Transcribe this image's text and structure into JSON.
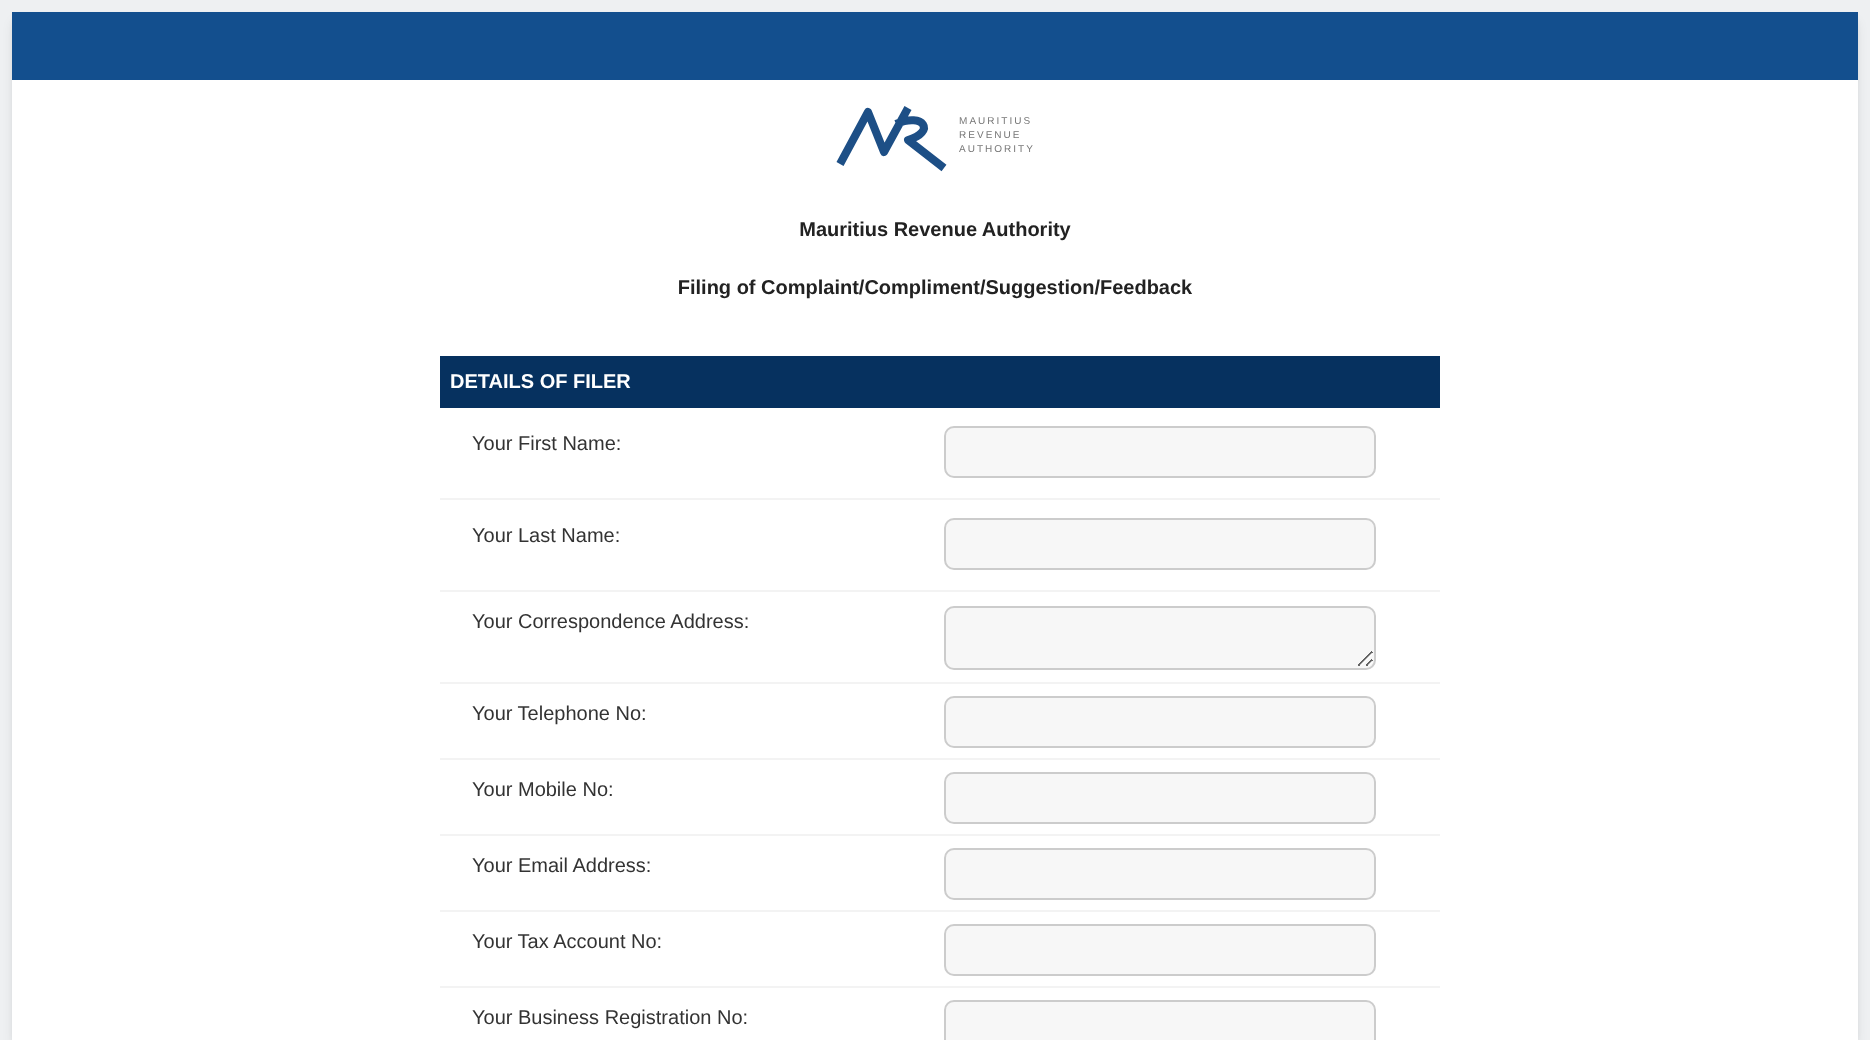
{
  "logo": {
    "lines": [
      "MAURITIUS",
      "REVENUE",
      "AUTHORITY"
    ]
  },
  "title": "Mauritius Revenue Authority",
  "subtitle": "Filing of Complaint/Compliment/Suggestion/Feedback",
  "section": {
    "heading": "DETAILS OF FILER",
    "fields": [
      {
        "label": "Your First Name:",
        "kind": "input"
      },
      {
        "label": "Your Last Name:",
        "kind": "input"
      },
      {
        "label": "Your Correspondence Address:",
        "kind": "textarea"
      },
      {
        "label": "Your Telephone No:",
        "kind": "input"
      },
      {
        "label": "Your Mobile No:",
        "kind": "input"
      },
      {
        "label": "Your Email Address:",
        "kind": "input"
      },
      {
        "label": "Your Tax Account No:",
        "kind": "input"
      },
      {
        "label": "Your Business Registration No:",
        "kind": "input"
      }
    ]
  }
}
